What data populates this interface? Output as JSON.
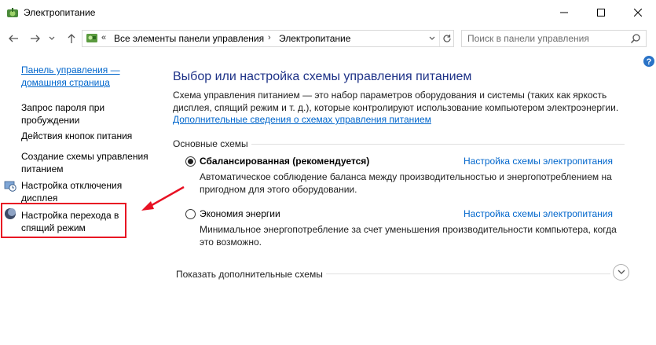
{
  "window": {
    "title": "Электропитание"
  },
  "address": {
    "chevron": "«",
    "crumbs": [
      "Все элементы панели управления",
      "Электропитание"
    ],
    "separator": "›"
  },
  "search": {
    "placeholder": "Поиск в панели управления"
  },
  "sidebar": {
    "home_link": "Панель управления — домашняя страница",
    "items": [
      "Запрос пароля при пробуждении",
      "Действия кнопок питания",
      "Создание схемы управления питанием",
      "Настройка отключения дисплея",
      "Настройка перехода в спящий режим"
    ]
  },
  "main": {
    "heading": "Выбор или настройка схемы управления питанием",
    "description": "Схема управления питанием — это набор параметров оборудования и системы (таких как яркость дисплея, спящий режим и т. д.), которые контролируют использование компьютером электроэнергии.",
    "more_info_link": "Дополнительные сведения о схемах управления питанием",
    "group_title": "Основные схемы",
    "plans": [
      {
        "name": "Сбалансированная (рекомендуется)",
        "selected": true,
        "settings_link": "Настройка схемы электропитания",
        "description": "Автоматическое соблюдение баланса между производительностью и энергопотреблением на пригодном для этого оборудовании."
      },
      {
        "name": "Экономия энергии",
        "selected": false,
        "settings_link": "Настройка схемы электропитания",
        "description": "Минимальное энергопотребление за счет уменьшения производительности компьютера, когда это возможно."
      }
    ],
    "show_more": "Показать дополнительные схемы"
  },
  "colors": {
    "link": "#0066cc",
    "heading": "#1e3287",
    "highlight": "#e81123"
  }
}
